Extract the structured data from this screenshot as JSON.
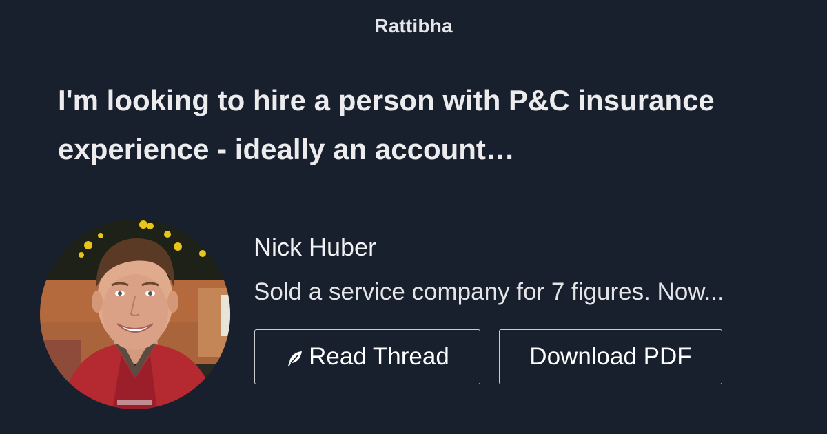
{
  "brand": {
    "name": "Rattibha"
  },
  "thread": {
    "title": "I'm looking to hire a person with P&C insurance experience - ideally an account…"
  },
  "author": {
    "name": "Nick Huber",
    "bio": "Sold a service company for 7 figures. Now..."
  },
  "actions": {
    "read_label": "Read Thread",
    "download_label": "Download PDF"
  },
  "icons": {
    "read": "feather-icon",
    "avatar": "profile-photo"
  },
  "colors": {
    "background": "#18202d",
    "text": "#ececee",
    "button_border": "#c9cbd0"
  }
}
